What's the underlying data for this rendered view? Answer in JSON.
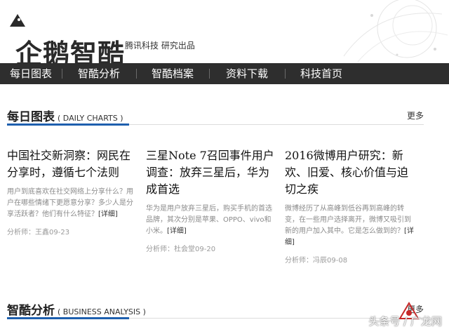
{
  "header": {
    "logo_text": "企鹅智酷",
    "tagline": "腾讯科技 研究出品"
  },
  "nav": {
    "items": [
      {
        "label": "每日图表"
      },
      {
        "label": "智酷分析"
      },
      {
        "label": "智酷档案"
      },
      {
        "label": "资料下载"
      },
      {
        "label": "科技首页"
      }
    ]
  },
  "daily_charts": {
    "title": "每日图表",
    "subtitle": "( DAILY CHARTS )",
    "more": "更多",
    "articles": [
      {
        "headline": "中国社交新洞察：网民在分享时，遵循七个法则",
        "summary": "用户到底喜欢在社交网络上分享什么？用户在哪些情绪下更愿意分享？多少人是分享活跃者？他们有什么特征？",
        "detail": "[详细]",
        "meta": "分析师：王鑫09-23"
      },
      {
        "headline": "三星Note 7召回事件用户调查：放弃三星后，华为成首选",
        "summary": "华为是用户放弃三星后，购买手机的首选品牌，其次分别是苹果、OPPO、vivo和小米。",
        "detail": "[详细]",
        "meta": "分析师：杜会堂09-20"
      },
      {
        "headline": "2016微博用户研究：新欢、旧爱、核心价值与迫切之疾",
        "summary": "微博经历了从高峰到低谷再到高峰的转变，在一些用户选择离开，微博又吸引到新的用户加入其中。它是怎么做到的？",
        "detail": "[详细]",
        "meta": "分析师：冯辰09-08"
      }
    ]
  },
  "business_analysis": {
    "title": "智酷分析",
    "subtitle": "( BUSINESS ANALYSIS )",
    "more": "更多"
  },
  "watermark": {
    "text": "头条号 / 广龙网"
  },
  "colors": {
    "nav_bg": "#2e2e2e",
    "accent": "#1e5fae"
  }
}
